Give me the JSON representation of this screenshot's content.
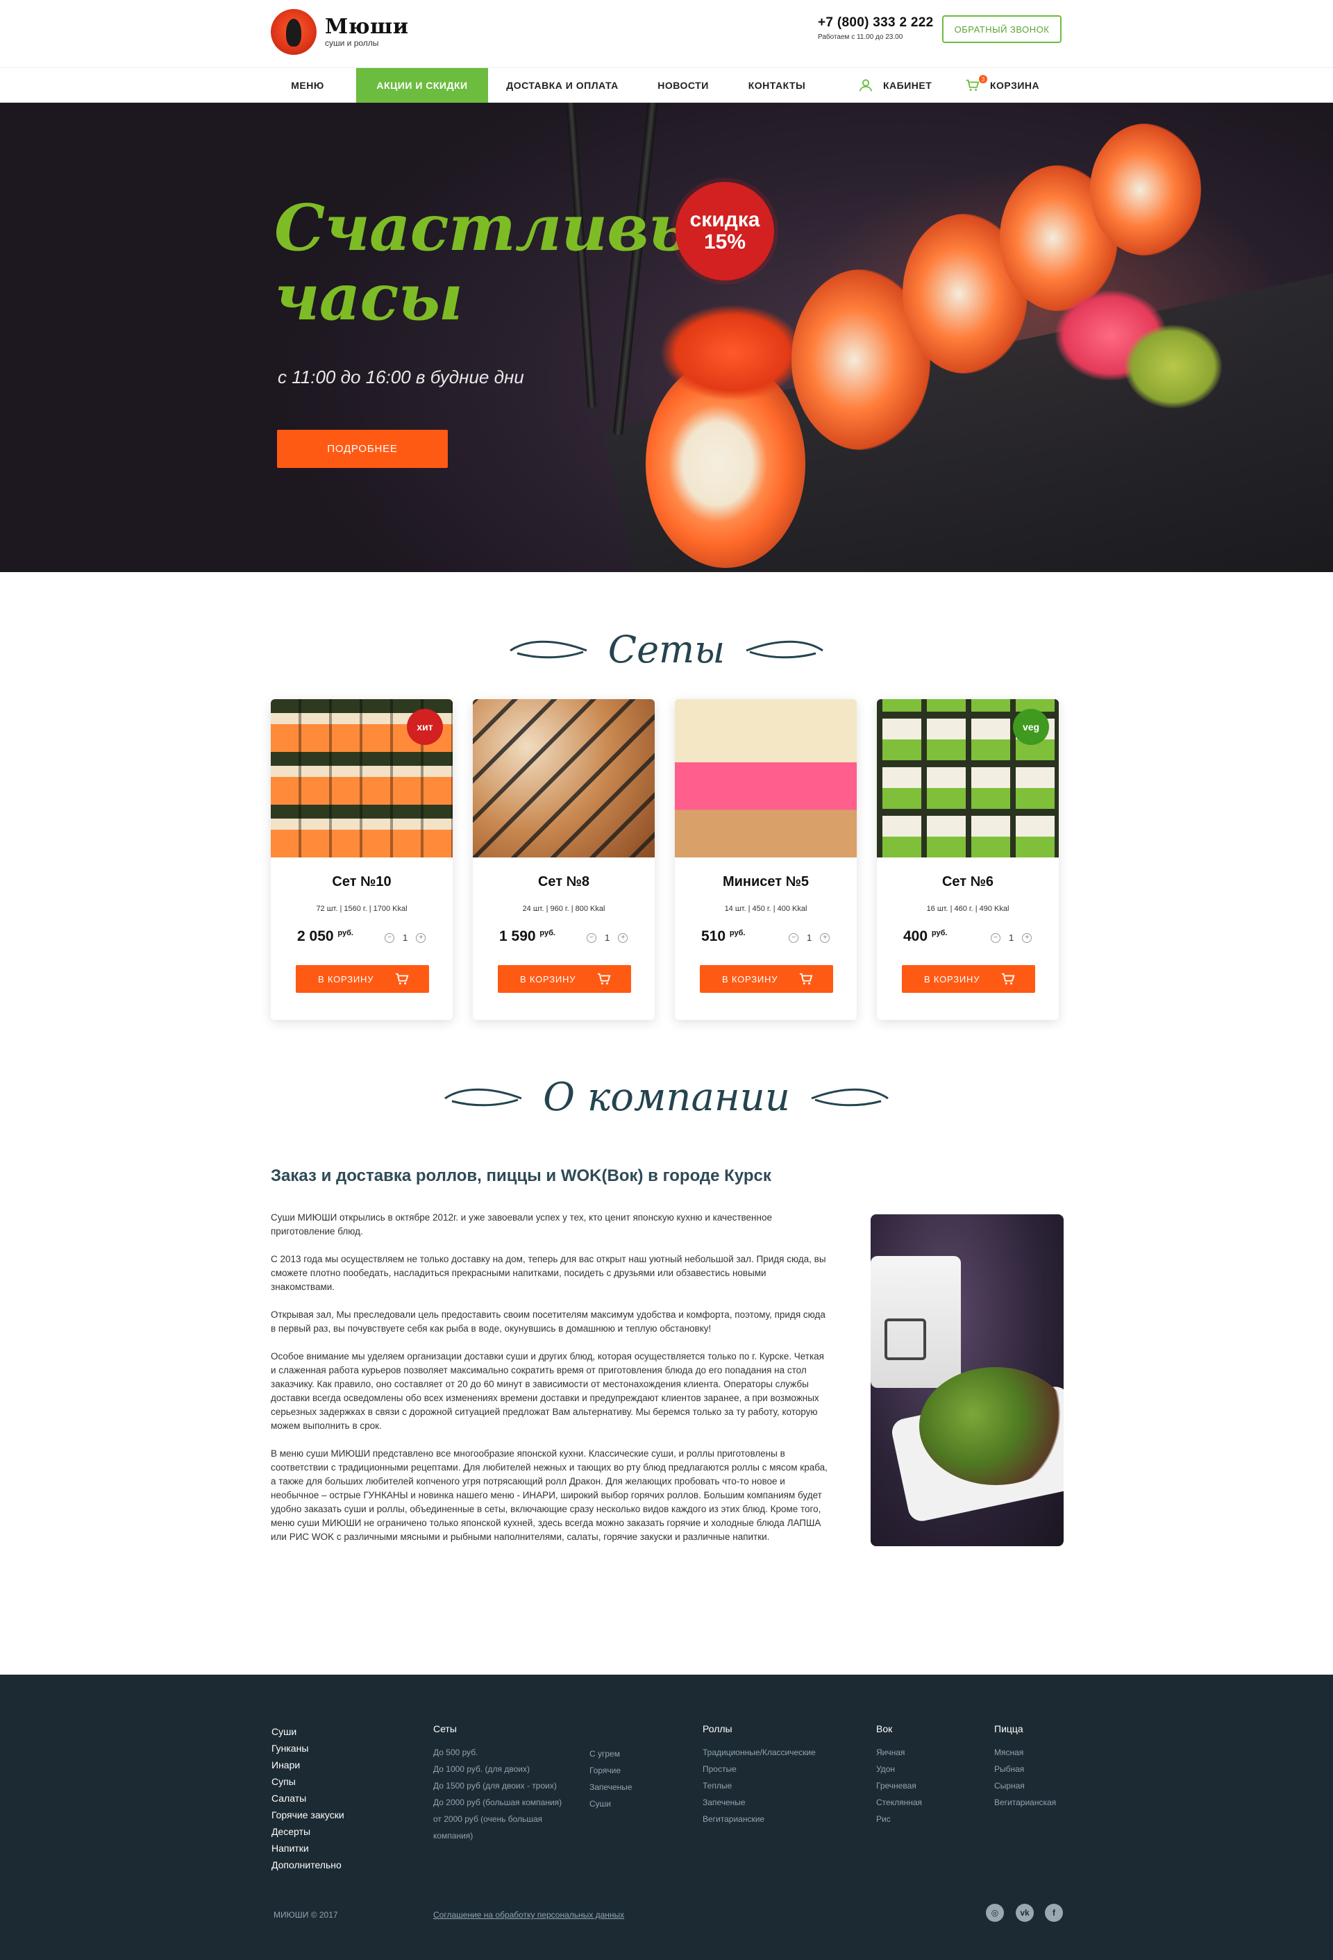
{
  "header": {
    "logo_name": "Мюши",
    "logo_tagline": "суши и роллы",
    "phone": "+7 (800) 333 2 222",
    "hours": "Работаем с 11.00 до 23.00",
    "callback_label": "ОБРАТНЫЙ ЗВОНОК"
  },
  "nav": {
    "items": [
      {
        "label": "МЕНЮ"
      },
      {
        "label": "АКЦИИ И СКИДКИ"
      },
      {
        "label": "ДОСТАВКА И ОПЛАТА"
      },
      {
        "label": "НОВОСТИ"
      },
      {
        "label": "КОНТАКТЫ"
      }
    ],
    "cabinet_label": "КАБИНЕТ",
    "cart_label": "КОРЗИНА",
    "cart_count": "3",
    "active_color": "#6cbc3f"
  },
  "hero": {
    "title_line1": "Счастливые",
    "title_line2": "часы",
    "subtitle": "с 11:00 до 16:00 в будние дни",
    "button_label": "ПОДРОБНЕЕ",
    "discount_line1": "скидка",
    "discount_line2": "15%",
    "accent_color": "#7ebc26",
    "button_color": "#ff5a14"
  },
  "sets_section": {
    "title": "Сеты",
    "items": [
      {
        "name": "Сет №10",
        "specs": "72 шт. | 1560 г. | 1700 Kkal",
        "price": "2 050",
        "currency": "руб.",
        "qty": "1",
        "button": "В КОРЗИНУ",
        "badge": "хит",
        "badge_color": "#d32020"
      },
      {
        "name": "Сет №8",
        "specs": "24 шт. | 960 г. | 800 Kkal",
        "price": "1 590",
        "currency": "руб.",
        "qty": "1",
        "button": "В КОРЗИНУ",
        "badge": "",
        "badge_color": ""
      },
      {
        "name": "Минисет №5",
        "specs": "14 шт. | 450 г. | 400 Kkal",
        "price": "510",
        "currency": "руб.",
        "qty": "1",
        "button": "В КОРЗИНУ",
        "badge": "",
        "badge_color": ""
      },
      {
        "name": "Сет №6",
        "specs": "16 шт. | 460 г. | 490 Kkal",
        "price": "400",
        "currency": "руб.",
        "qty": "1",
        "button": "В КОРЗИНУ",
        "badge": "veg",
        "badge_color": "#3f9a1f"
      }
    ]
  },
  "about": {
    "title": "О компании",
    "heading": "Заказ и доставка роллов, пиццы и WOK(Вок) в городе Курск",
    "paragraphs": [
      "Суши МИЮШИ открылись в октябре 2012г. и уже завоевали успех у тех, кто ценит японскую кухню и качественное приготовление блюд.",
      "С 2013 года мы осуществляем не только доставку на дом, теперь для вас открыт наш уютный небольшой зал. Придя сюда, вы сможете плотно пообедать, насладиться прекрасными напитками, посидеть с друзьями или обзавестись новыми знакомствами.",
      "Открывая зал, Мы преследовали цель предоставить своим посетителям максимум удобства и комфорта, поэтому, придя сюда в первый раз, вы почувствуете себя как рыба в воде, окунувшись в домашнюю и теплую обстановку!",
      "Особое внимание мы уделяем организации доставки суши и других блюд, которая осуществляется только по г. Курске. Четкая и слаженная работа курьеров позволяет максимально сократить время от приготовления блюда до его попадания на стол заказчику. Как правило, оно составляет от 20 до 60 минут в зависимости от местонахождения клиента. Операторы службы доставки всегда осведомлены обо всех изменениях времени доставки и предупреждают клиентов заранее, а при возможных серьезных задержках в связи с дорожной ситуацией предложат Вам альтернативу. Мы беремся только за ту работу, которую можем выполнить в срок.",
      "В меню суши МИЮШИ представлено все многообразие японской кухни. Классические суши, и роллы приготовлены в соответствии с традиционными рецептами. Для любителей нежных и тающих во рту блюд предлагаются роллы с мясом краба, а также для больших любителей копченого угря потрясающий ролл Дракон. Для желающих пробовать что-то новое и необычное – острые ГУНКАНЫ и новинка нашего меню - ИНАРИ, широкий выбор горячих роллов. Большим компаниям будет удобно заказать суши и роллы, объединенные в сеты, включающие сразу несколько видов каждого из этих блюд. Кроме того, меню суши МИЮШИ не ограничено только японской кухней, здесь всегда можно заказать горячие и холодные блюда ЛАПША или РИС WOK с различными мясными и рыбными наполнителями, салаты, горячие закуски и различные напитки."
    ]
  },
  "footer": {
    "main_links": [
      "Суши",
      "Гунканы",
      "Инари",
      "Супы",
      "Салаты",
      "Горячие закуски",
      "Десерты",
      "Напитки",
      "Дополнительно"
    ],
    "sets": {
      "head": "Сеты",
      "col1": [
        "До 500 руб.",
        "До 1000 руб. (для двоих)",
        "До 1500 руб (для двоих - троих)",
        "До 2000 руб (большая компания)",
        "от 2000 руб (очень большая",
        "компания)"
      ],
      "col2": [
        "С угрем",
        "Горячие",
        "Запеченые",
        "Суши"
      ]
    },
    "rolls": {
      "head": "Роллы",
      "items": [
        "Традиционные/Классические",
        "Простые",
        "Теплые",
        "Запеченые",
        "Вегитарианские"
      ]
    },
    "wok": {
      "head": "Вок",
      "items": [
        "Яичная",
        "Удон",
        "Гречневая",
        "Стеклянная",
        "Рис"
      ]
    },
    "pizza": {
      "head": "Пицца",
      "items": [
        "Мясная",
        "Рыбная",
        "Сырная",
        "Вегитарианская"
      ]
    },
    "copyright": "МИЮШИ © 2017",
    "agreement": "Соглашение на обработку персональных данных",
    "social": [
      {
        "icon": "instagram-icon",
        "glyph": "◎"
      },
      {
        "icon": "vk-icon",
        "glyph": "vk"
      },
      {
        "icon": "facebook-icon",
        "glyph": "f"
      }
    ]
  }
}
